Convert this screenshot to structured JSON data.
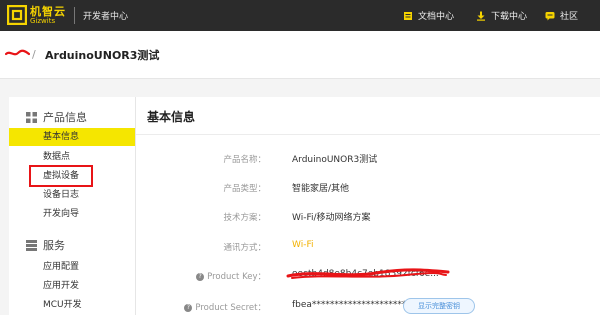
{
  "topbar": {
    "logo_cn": "机智云",
    "logo_en": "Gizwits",
    "dev_center": "开发者中心",
    "nav": [
      {
        "label": "文档中心",
        "icon": "document-icon"
      },
      {
        "label": "下载中心",
        "icon": "download-icon"
      },
      {
        "label": "社区",
        "icon": "community-icon"
      }
    ]
  },
  "breadcrumb": {
    "separator": "/",
    "current": "ArduinoUNOR3测试"
  },
  "sidebar": {
    "sections": [
      {
        "title": "产品信息",
        "icon": "grid-icon",
        "items": [
          "基本信息",
          "数据点",
          "虚拟设备",
          "设备日志",
          "开发向导"
        ]
      },
      {
        "title": "服务",
        "icon": "stack-icon",
        "items": [
          "应用配置",
          "应用开发",
          "MCU开发"
        ]
      }
    ],
    "active_item": "基本信息",
    "highlighted_item": "虚拟设备"
  },
  "main": {
    "title": "基本信息",
    "rows": [
      {
        "label": "产品名称：",
        "value": "ArduinoUNOR3测试"
      },
      {
        "label": "产品类型：",
        "value": "智能家居/其他"
      },
      {
        "label": "技术方案：",
        "value": "Wi-Fi/移动网络方案"
      },
      {
        "label": "通讯方式：",
        "value": "Wi-Fi"
      },
      {
        "label": "Product Key：",
        "value": "oectb4d8e8b4c7eb18392fcf6e..."
      },
      {
        "label": "Product Secret：",
        "value": "fbea*********************261f"
      }
    ],
    "secret_button": "显示完整密钥"
  },
  "colors": {
    "topbar_bg": "#2b2b2b",
    "accent_yellow": "#f5e600",
    "logo_yellow": "#f5d300",
    "wifi_orange": "#f2b100",
    "highlight_red": "#e81417"
  }
}
